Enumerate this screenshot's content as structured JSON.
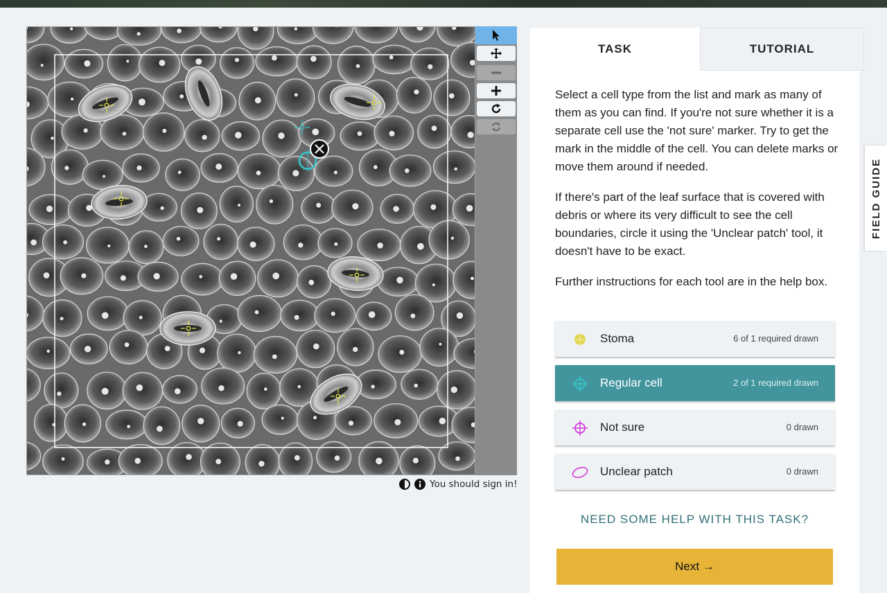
{
  "subject_viewer": {
    "image_description_icon": "leaf-surface-micrograph",
    "annotation_colors": {
      "stoma": "#e6e84a",
      "regular_cell": "#35c6d0",
      "selected_outline": "#ffffff"
    }
  },
  "toolbar": {
    "buttons": [
      {
        "name": "annotate-pointer",
        "icon": "pointer-icon",
        "state": "active"
      },
      {
        "name": "pan",
        "icon": "move-icon",
        "state": "enabled"
      },
      {
        "name": "zoom-out",
        "icon": "minus-icon",
        "state": "disabled"
      },
      {
        "name": "zoom-in",
        "icon": "plus-icon",
        "state": "enabled"
      },
      {
        "name": "rotate",
        "icon": "rotate-icon",
        "state": "enabled"
      },
      {
        "name": "reset",
        "icon": "reset-icon",
        "state": "disabled"
      }
    ]
  },
  "meta": {
    "signin_text": "You should sign in!",
    "icons": [
      "invert-icon",
      "info-icon"
    ]
  },
  "tabs": [
    {
      "label": "TASK",
      "active": true
    },
    {
      "label": "TUTORIAL",
      "active": false
    }
  ],
  "instructions": {
    "p1": "Select a cell type from the list and mark as many of them as you can find. If you're not sure whether it is a separate cell use the 'not sure' marker. Try to get the mark in the middle of the cell. You can delete marks or move them around if needed.",
    "p2": "If there's part of the leaf surface that is covered with debris or where its very difficult to see the cell boundaries, circle it using the 'Unclear patch' tool, it doesn't have to be exact.",
    "p3": "Further instructions for each tool are in the help box."
  },
  "tools": [
    {
      "label": "Stoma",
      "count": "6 of 1 required drawn",
      "color": "#e0d23a",
      "icon": "stoma-crosshair-icon",
      "active": false
    },
    {
      "label": "Regular cell",
      "count": "2 of 1 required drawn",
      "color": "#35c6d0",
      "icon": "regular-cell-crosshair-icon",
      "active": true
    },
    {
      "label": "Not sure",
      "count": "0 drawn",
      "color": "#d23bd6",
      "icon": "not-sure-crosshair-icon",
      "active": false
    },
    {
      "label": "Unclear patch",
      "count": "0 drawn",
      "color": "#d23bd6",
      "icon": "ellipse-icon",
      "active": false
    }
  ],
  "help_link": "NEED SOME HELP WITH THIS TASK?",
  "next_button": "Next →",
  "field_guide": "FIELD GUIDE",
  "colors": {
    "accent_teal": "#43959d",
    "next_yellow": "#e7b437",
    "help_text": "#2f6e76"
  }
}
